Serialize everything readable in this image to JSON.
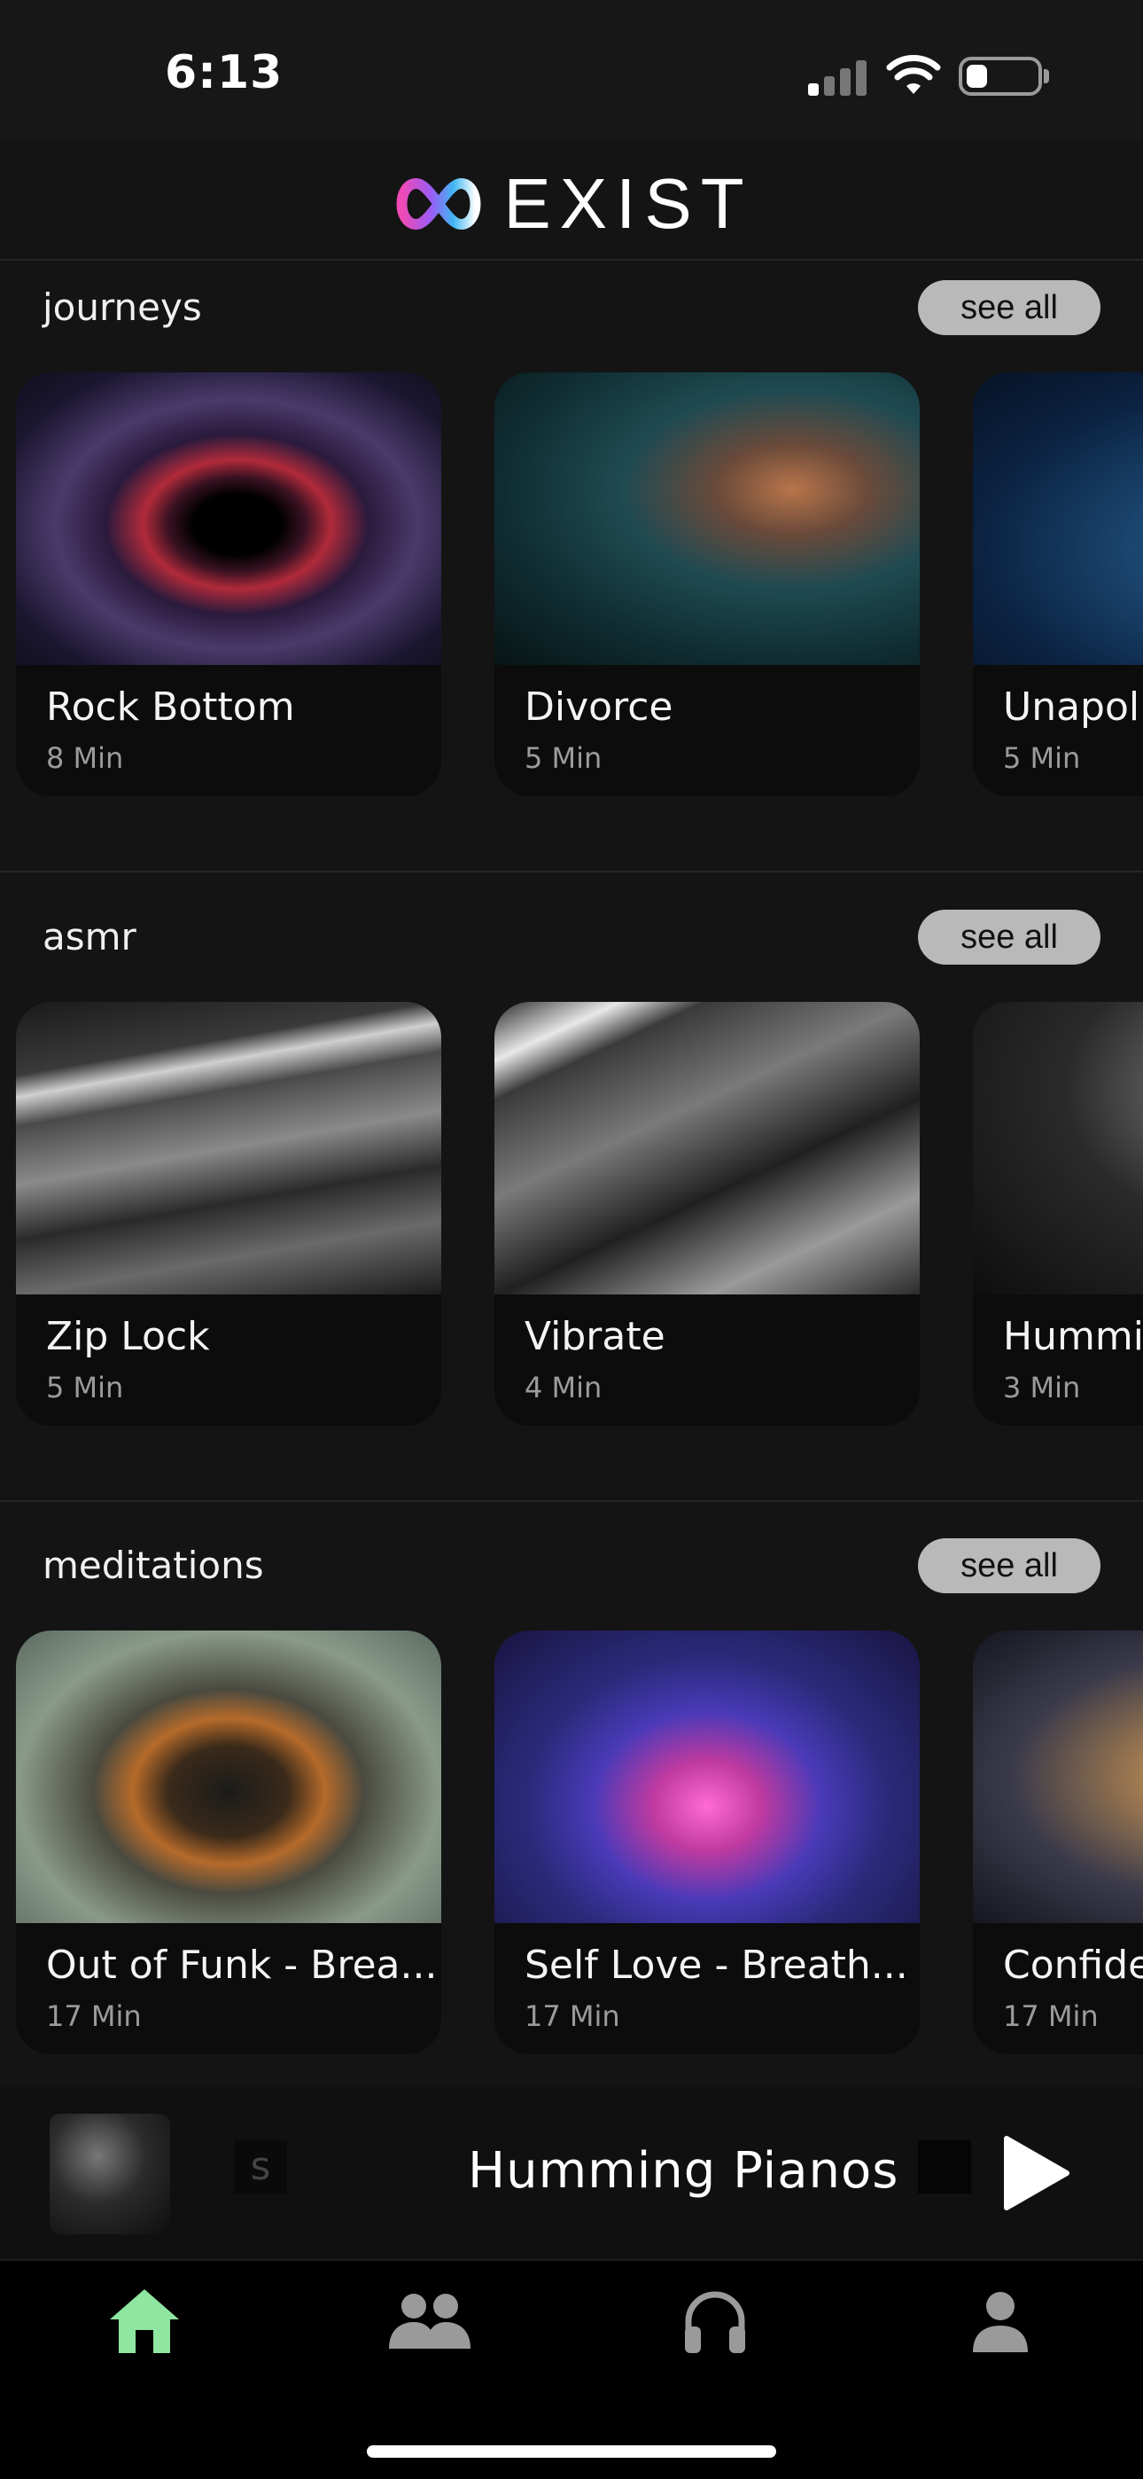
{
  "status_bar": {
    "time": "6:13",
    "battery_level": 0.3
  },
  "header": {
    "logo_text": "EXIST",
    "logo_icon": "infinity-icon"
  },
  "sections": [
    {
      "title": "journeys",
      "see_all": "see all",
      "cards": [
        {
          "title": "Rock Bottom",
          "duration": "8 Min"
        },
        {
          "title": "Divorce",
          "duration": "5 Min"
        },
        {
          "title": "Unapol",
          "duration": "5 Min"
        }
      ]
    },
    {
      "title": "asmr",
      "see_all": "see all",
      "cards": [
        {
          "title": "Zip Lock",
          "duration": "5 Min"
        },
        {
          "title": "Vibrate",
          "duration": "4 Min"
        },
        {
          "title": "Hummi",
          "duration": "3 Min"
        }
      ]
    },
    {
      "title": "meditations",
      "see_all": "see all",
      "cards": [
        {
          "title": "Out of Funk - Brea...",
          "duration": "17 Min"
        },
        {
          "title": "Self Love - Breath...",
          "duration": "17 Min"
        },
        {
          "title": "Confide",
          "duration": "17 Min"
        }
      ]
    }
  ],
  "player": {
    "scroll_text": "s",
    "title": "Humming Pianos"
  },
  "tabs": [
    {
      "name": "home-icon",
      "active": true
    },
    {
      "name": "community-icon",
      "active": false
    },
    {
      "name": "headphones-icon",
      "active": false
    },
    {
      "name": "profile-icon",
      "active": false
    }
  ],
  "colors": {
    "accent": "#8ee6a0",
    "background": "#141414",
    "pill": "#b9b9b9"
  }
}
